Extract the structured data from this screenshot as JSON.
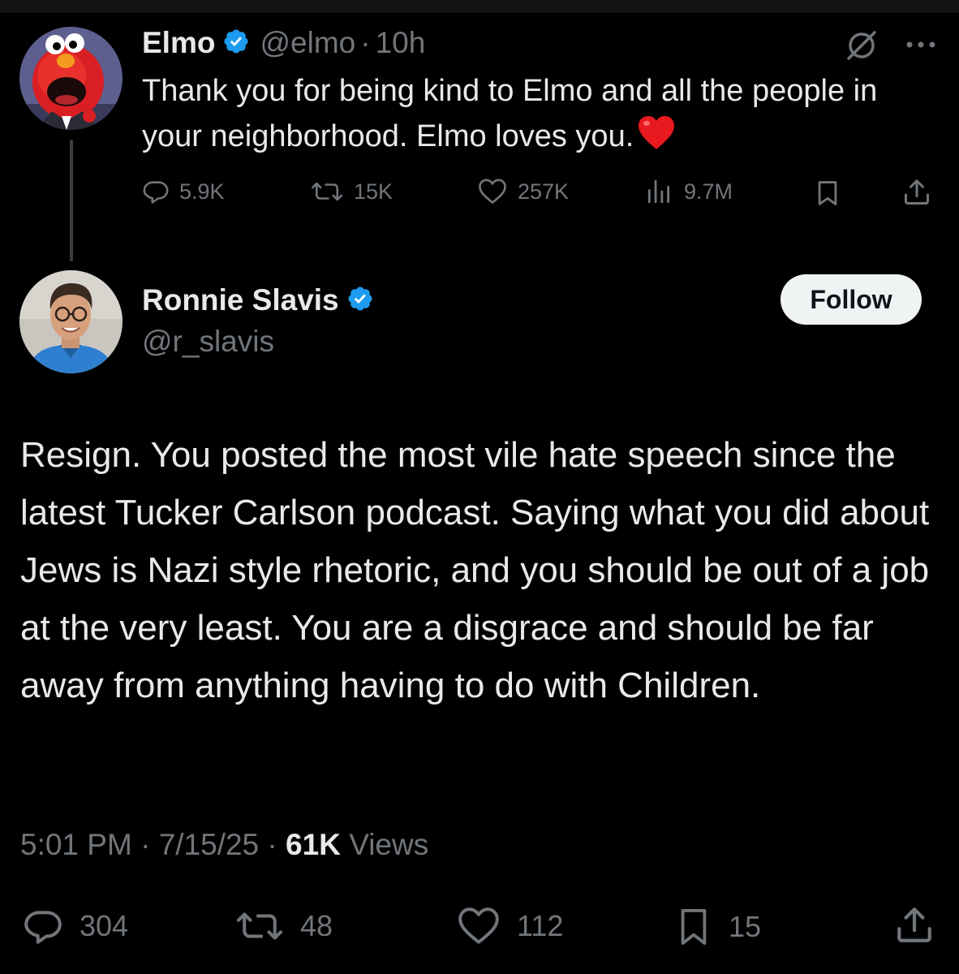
{
  "parent_tweet": {
    "name": "Elmo",
    "handle": "@elmo",
    "separator": "·",
    "time": "10h",
    "text": "Thank you for being kind to Elmo and all the people in your neighborhood. Elmo loves you.",
    "emoji": "heart-emoji",
    "stats": {
      "replies": "5.9K",
      "reposts": "15K",
      "likes": "257K",
      "views": "9.7M"
    }
  },
  "reply_tweet": {
    "name": "Ronnie Slavis",
    "handle": "@r_slavis",
    "follow_label": "Follow",
    "text": "Resign. You posted the most vile hate speech since the latest Tucker Carlson podcast. Saying what you did about Jews is Nazi style rhetoric, and you should be out of a job at the very least. You are a disgrace and should be far away from anything having to do with Children.",
    "timestamp": "5:01 PM",
    "sep1": "·",
    "date": "7/15/25",
    "sep2": "·",
    "views_count": "61K",
    "views_label": "Views",
    "stats": {
      "replies": "304",
      "reposts": "48",
      "likes": "112",
      "bookmarks": "15"
    }
  },
  "colors": {
    "background": "#000000",
    "text_primary": "#e7e9ea",
    "text_secondary": "#71767b",
    "verified_blue": "#1d9bf0",
    "follow_button_bg": "#eff3f4"
  },
  "icons": [
    "reply-icon",
    "repost-icon",
    "like-icon",
    "views-icon",
    "bookmark-icon",
    "share-icon",
    "grok-icon",
    "more-icon",
    "verified-badge-icon"
  ]
}
